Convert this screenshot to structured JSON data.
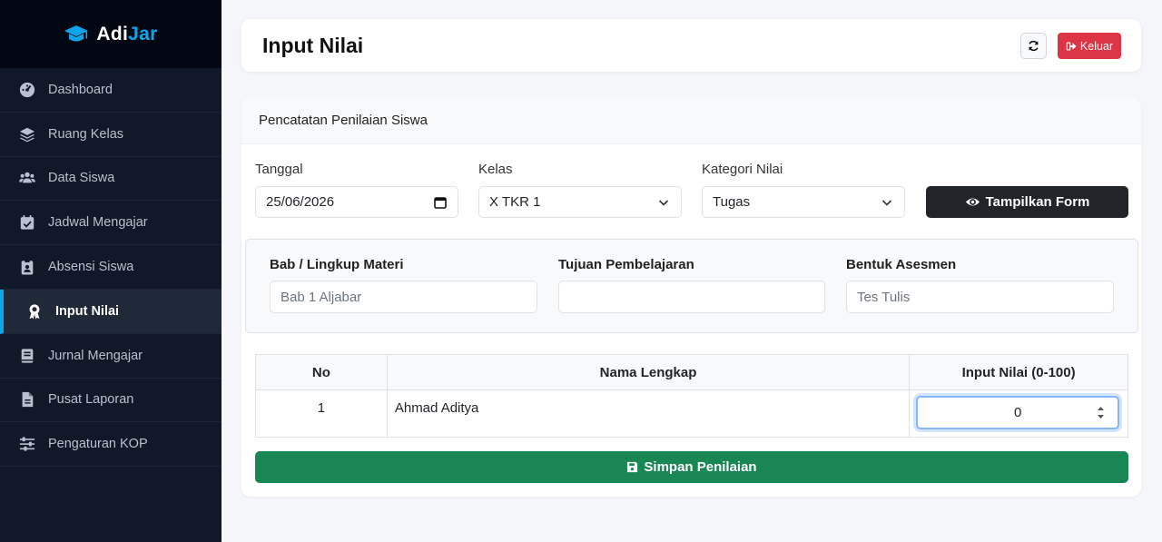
{
  "brand": {
    "name_primary": "Adi",
    "name_accent": "Jar",
    "icon": "graduation-cap-icon"
  },
  "sidebar": {
    "items": [
      {
        "label": "Dashboard",
        "icon": "gauge-icon",
        "active": false
      },
      {
        "label": "Ruang Kelas",
        "icon": "layers-icon",
        "active": false
      },
      {
        "label": "Data Siswa",
        "icon": "users-icon",
        "active": false
      },
      {
        "label": "Jadwal Mengajar",
        "icon": "calendar-check-icon",
        "active": false
      },
      {
        "label": "Absensi Siswa",
        "icon": "clipboard-user-icon",
        "active": false
      },
      {
        "label": "Input Nilai",
        "icon": "award-icon",
        "active": true
      },
      {
        "label": "Jurnal Mengajar",
        "icon": "book-icon",
        "active": false
      },
      {
        "label": "Pusat Laporan",
        "icon": "file-icon",
        "active": false
      },
      {
        "label": "Pengaturan KOP",
        "icon": "sliders-icon",
        "active": false
      }
    ]
  },
  "header": {
    "title": "Input Nilai",
    "logout_label": "Keluar"
  },
  "card": {
    "title": "Pencatatan Penilaian Siswa"
  },
  "form": {
    "date_label": "Tanggal",
    "date_value": "25/06/2026",
    "class_label": "Kelas",
    "class_value": "X TKR 1",
    "category_label": "Kategori Nilai",
    "category_value": "Tugas",
    "show_button": "Tampilkan Form"
  },
  "details": {
    "chapter_label": "Bab / Lingkup Materi",
    "chapter_value": "Bab 1 Aljabar",
    "objective_label": "Tujuan Pembelajaran",
    "objective_value": "",
    "assessment_label": "Bentuk Asesmen",
    "assessment_value": "Tes Tulis"
  },
  "table": {
    "headers": [
      "No",
      "Nama Lengkap",
      "Input Nilai (0-100)"
    ],
    "rows": [
      {
        "no": "1",
        "name": "Ahmad Aditya",
        "score": "0"
      }
    ]
  },
  "save_button": "Simpan Penilaian",
  "colors": {
    "sidebar_bg": "#111827",
    "accent": "#0ea5e9",
    "danger": "#dc3545",
    "success": "#198754",
    "dark_button": "#212529"
  }
}
